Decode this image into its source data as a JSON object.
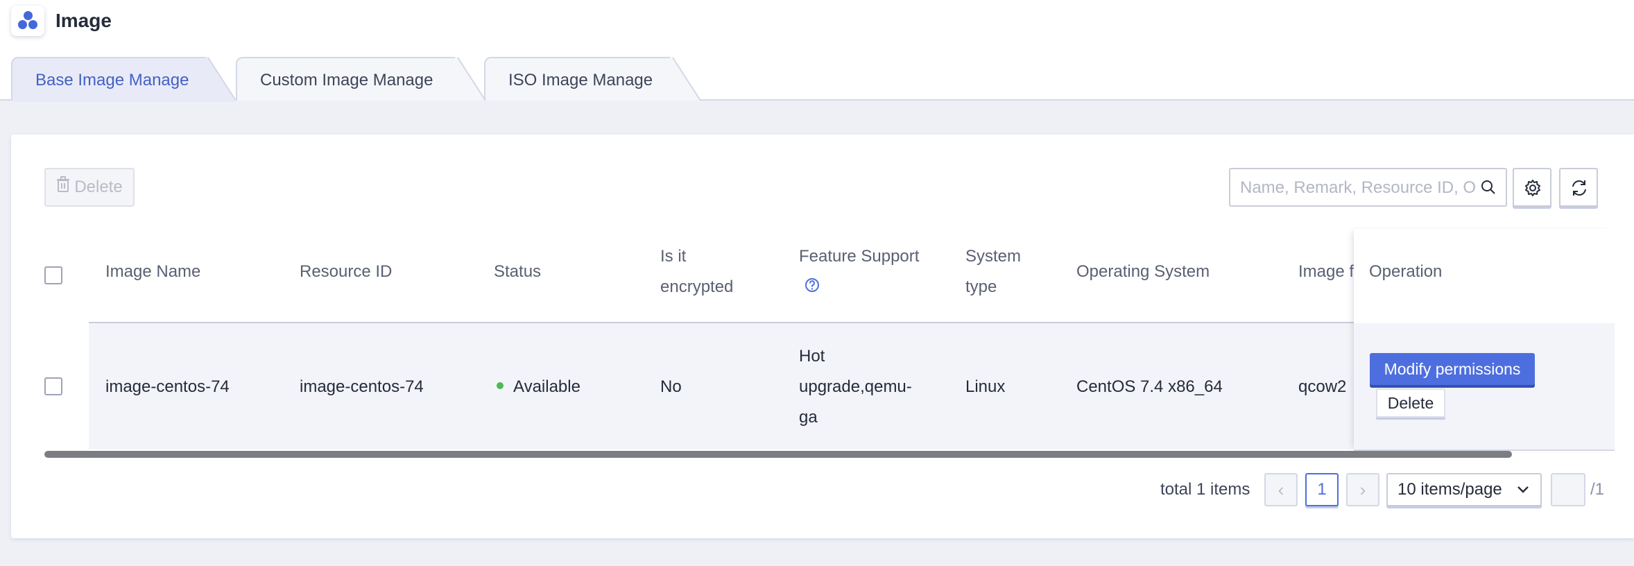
{
  "header": {
    "title": "Image",
    "logo_icon": "cluster-logo-icon",
    "tabs": [
      {
        "label": "Base Image Manage",
        "active": true
      },
      {
        "label": "Custom Image Manage",
        "active": false
      },
      {
        "label": "ISO Image Manage",
        "active": false
      }
    ]
  },
  "toolbar": {
    "delete_label": "Delete",
    "search_placeholder": "Name, Remark, Resource ID, OS",
    "settings_icon": "gear-icon",
    "refresh_icon": "refresh-icon"
  },
  "table": {
    "columns": {
      "name": "Image Name",
      "resource_id": "Resource ID",
      "status": "Status",
      "encrypted": "Is it encrypted",
      "feature": "Feature Support",
      "system_type": "System type",
      "os": "Operating System",
      "image_format": "Image f",
      "operation": "Operation"
    },
    "rows": [
      {
        "name": "image-centos-74",
        "resource_id": "image-centos-74",
        "status": "Available",
        "encrypted": "No",
        "feature": "Hot upgrade,qemu-ga",
        "system_type": "Linux",
        "os": "CentOS 7.4 x86_64",
        "image_format": "qcow2",
        "actions": [
          "Modify permissions",
          "Delete"
        ]
      }
    ]
  },
  "pagination": {
    "total_text": "total 1 items",
    "current_page": "1",
    "page_size": "10 items/page",
    "total_pages_text": "/1"
  },
  "colors": {
    "primary": "#4d6ede",
    "status_available": "#4eb855"
  }
}
